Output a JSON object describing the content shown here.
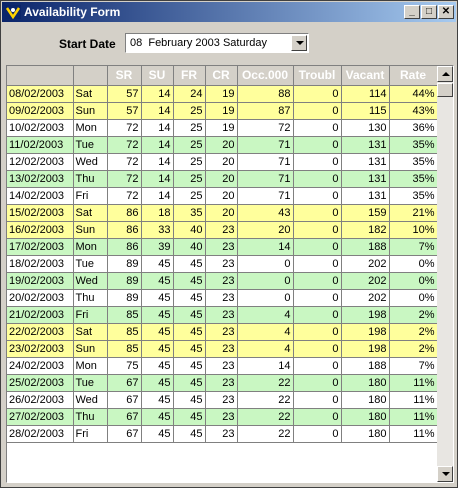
{
  "window": {
    "title": "Availability Form",
    "minimize": "_",
    "maximize": "□",
    "close": "✕"
  },
  "form": {
    "start_date_label": "Start Date",
    "start_date_value": "08  February 2003 Saturday"
  },
  "table": {
    "columns": [
      "",
      "",
      "SR",
      "SU",
      "FR",
      "CR",
      "Occ.000",
      "Troubl",
      "Vacant",
      "Rate"
    ],
    "rows": [
      {
        "c": "yellow",
        "cells": [
          "08/02/2003",
          "Sat",
          "57",
          "14",
          "24",
          "19",
          "88",
          "0",
          "114",
          "44%"
        ]
      },
      {
        "c": "yellow",
        "cells": [
          "09/02/2003",
          "Sun",
          "57",
          "14",
          "25",
          "19",
          "87",
          "0",
          "115",
          "43%"
        ]
      },
      {
        "c": "white",
        "cells": [
          "10/02/2003",
          "Mon",
          "72",
          "14",
          "25",
          "19",
          "72",
          "0",
          "130",
          "36%"
        ]
      },
      {
        "c": "green",
        "cells": [
          "11/02/2003",
          "Tue",
          "72",
          "14",
          "25",
          "20",
          "71",
          "0",
          "131",
          "35%"
        ]
      },
      {
        "c": "white",
        "cells": [
          "12/02/2003",
          "Wed",
          "72",
          "14",
          "25",
          "20",
          "71",
          "0",
          "131",
          "35%"
        ]
      },
      {
        "c": "green",
        "cells": [
          "13/02/2003",
          "Thu",
          "72",
          "14",
          "25",
          "20",
          "71",
          "0",
          "131",
          "35%"
        ]
      },
      {
        "c": "white",
        "cells": [
          "14/02/2003",
          "Fri",
          "72",
          "14",
          "25",
          "20",
          "71",
          "0",
          "131",
          "35%"
        ]
      },
      {
        "c": "yellow",
        "cells": [
          "15/02/2003",
          "Sat",
          "86",
          "18",
          "35",
          "20",
          "43",
          "0",
          "159",
          "21%"
        ]
      },
      {
        "c": "yellow",
        "cells": [
          "16/02/2003",
          "Sun",
          "86",
          "33",
          "40",
          "23",
          "20",
          "0",
          "182",
          "10%"
        ]
      },
      {
        "c": "green",
        "cells": [
          "17/02/2003",
          "Mon",
          "86",
          "39",
          "40",
          "23",
          "14",
          "0",
          "188",
          "7%"
        ]
      },
      {
        "c": "white",
        "cells": [
          "18/02/2003",
          "Tue",
          "89",
          "45",
          "45",
          "23",
          "0",
          "0",
          "202",
          "0%"
        ]
      },
      {
        "c": "green",
        "cells": [
          "19/02/2003",
          "Wed",
          "89",
          "45",
          "45",
          "23",
          "0",
          "0",
          "202",
          "0%"
        ]
      },
      {
        "c": "white",
        "cells": [
          "20/02/2003",
          "Thu",
          "89",
          "45",
          "45",
          "23",
          "0",
          "0",
          "202",
          "0%"
        ]
      },
      {
        "c": "green",
        "cells": [
          "21/02/2003",
          "Fri",
          "85",
          "45",
          "45",
          "23",
          "4",
          "0",
          "198",
          "2%"
        ]
      },
      {
        "c": "yellow",
        "cells": [
          "22/02/2003",
          "Sat",
          "85",
          "45",
          "45",
          "23",
          "4",
          "0",
          "198",
          "2%"
        ]
      },
      {
        "c": "yellow",
        "cells": [
          "23/02/2003",
          "Sun",
          "85",
          "45",
          "45",
          "23",
          "4",
          "0",
          "198",
          "2%"
        ]
      },
      {
        "c": "white",
        "cells": [
          "24/02/2003",
          "Mon",
          "75",
          "45",
          "45",
          "23",
          "14",
          "0",
          "188",
          "7%"
        ]
      },
      {
        "c": "green",
        "cells": [
          "25/02/2003",
          "Tue",
          "67",
          "45",
          "45",
          "23",
          "22",
          "0",
          "180",
          "11%"
        ]
      },
      {
        "c": "white",
        "cells": [
          "26/02/2003",
          "Wed",
          "67",
          "45",
          "45",
          "23",
          "22",
          "0",
          "180",
          "11%"
        ]
      },
      {
        "c": "green",
        "cells": [
          "27/02/2003",
          "Thu",
          "67",
          "45",
          "45",
          "23",
          "22",
          "0",
          "180",
          "11%"
        ]
      },
      {
        "c": "white",
        "cells": [
          "28/02/2003",
          "Fri",
          "67",
          "45",
          "45",
          "23",
          "22",
          "0",
          "180",
          "11%"
        ]
      }
    ]
  },
  "colors": {
    "title_start": "#0a246a",
    "title_end": "#a6caf0",
    "weekend": "#ffff9c",
    "alt": "#c9f7c2"
  }
}
